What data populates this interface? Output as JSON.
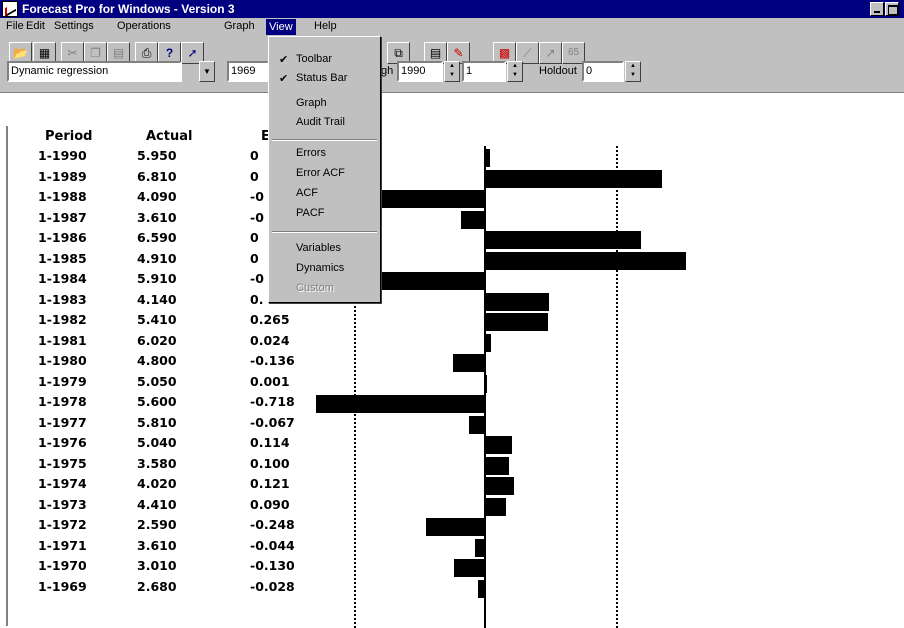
{
  "window": {
    "title": "Forecast Pro for Windows - Version 3"
  },
  "menubar": [
    "File",
    "Edit",
    "Settings",
    "Operations",
    "Graph",
    "View",
    "Help"
  ],
  "toolbar": {
    "model_select": "Dynamic regression",
    "from_value": "1969",
    "through_label": "gh",
    "through_value": "1990",
    "step_value": "1",
    "holdout_label": "Holdout",
    "holdout_value": "0"
  },
  "view_menu": {
    "items": [
      {
        "label": "Toolbar",
        "checked": true
      },
      {
        "label": "Status Bar",
        "checked": true
      },
      {
        "label": "Graph",
        "checked": false
      },
      {
        "label": "Audit Trail",
        "checked": false
      },
      {
        "label": "Errors",
        "checked": false
      },
      {
        "label": "Error ACF",
        "checked": false
      },
      {
        "label": "ACF",
        "checked": false
      },
      {
        "label": "PACF",
        "checked": false
      },
      {
        "label": "Variables",
        "checked": false
      },
      {
        "label": "Dynamics",
        "checked": false
      },
      {
        "label": "Custom",
        "checked": false,
        "disabled": true
      }
    ],
    "check_glyph": "✔"
  },
  "table": {
    "headers": [
      "Period",
      "Actual",
      "E"
    ],
    "rows": [
      {
        "period": "1-1990",
        "actual": "5.950",
        "error": "0",
        "value": 0.02
      },
      {
        "period": "1-1989",
        "actual": "6.810",
        "error": "0",
        "value": 0.75
      },
      {
        "period": "1-1988",
        "actual": "4.090",
        "error": "-0",
        "value": -0.72
      },
      {
        "period": "1-1987",
        "actual": "3.610",
        "error": "-0",
        "value": -0.1
      },
      {
        "period": "1-1986",
        "actual": "6.590",
        "error": "0",
        "value": 0.66
      },
      {
        "period": "1-1985",
        "actual": "4.910",
        "error": "0",
        "value": 0.85
      },
      {
        "period": "1-1984",
        "actual": "5.910",
        "error": "-0",
        "value": -0.66
      },
      {
        "period": "1-1983",
        "actual": "4.140",
        "error": "0.",
        "value": 0.27
      },
      {
        "period": "1-1982",
        "actual": "5.410",
        "error": "0.265",
        "value": 0.265
      },
      {
        "period": "1-1981",
        "actual": "6.020",
        "error": "0.024",
        "value": 0.024
      },
      {
        "period": "1-1980",
        "actual": "4.800",
        "error": "-0.136",
        "value": -0.136
      },
      {
        "period": "1-1979",
        "actual": "5.050",
        "error": "0.001",
        "value": 0.001
      },
      {
        "period": "1-1978",
        "actual": "5.600",
        "error": "-0.718",
        "value": -0.718
      },
      {
        "period": "1-1977",
        "actual": "5.810",
        "error": "-0.067",
        "value": -0.067
      },
      {
        "period": "1-1976",
        "actual": "5.040",
        "error": "0.114",
        "value": 0.114
      },
      {
        "period": "1-1975",
        "actual": "3.580",
        "error": "0.100",
        "value": 0.1
      },
      {
        "period": "1-1974",
        "actual": "4.020",
        "error": "0.121",
        "value": 0.121
      },
      {
        "period": "1-1973",
        "actual": "4.410",
        "error": "0.090",
        "value": 0.09
      },
      {
        "period": "1-1972",
        "actual": "2.590",
        "error": "-0.248",
        "value": -0.248
      },
      {
        "period": "1-1971",
        "actual": "3.610",
        "error": "-0.044",
        "value": -0.044
      },
      {
        "period": "1-1970",
        "actual": "3.010",
        "error": "-0.130",
        "value": -0.13
      },
      {
        "period": "1-1969",
        "actual": "2.680",
        "error": "-0.028",
        "value": -0.028
      }
    ]
  }
}
